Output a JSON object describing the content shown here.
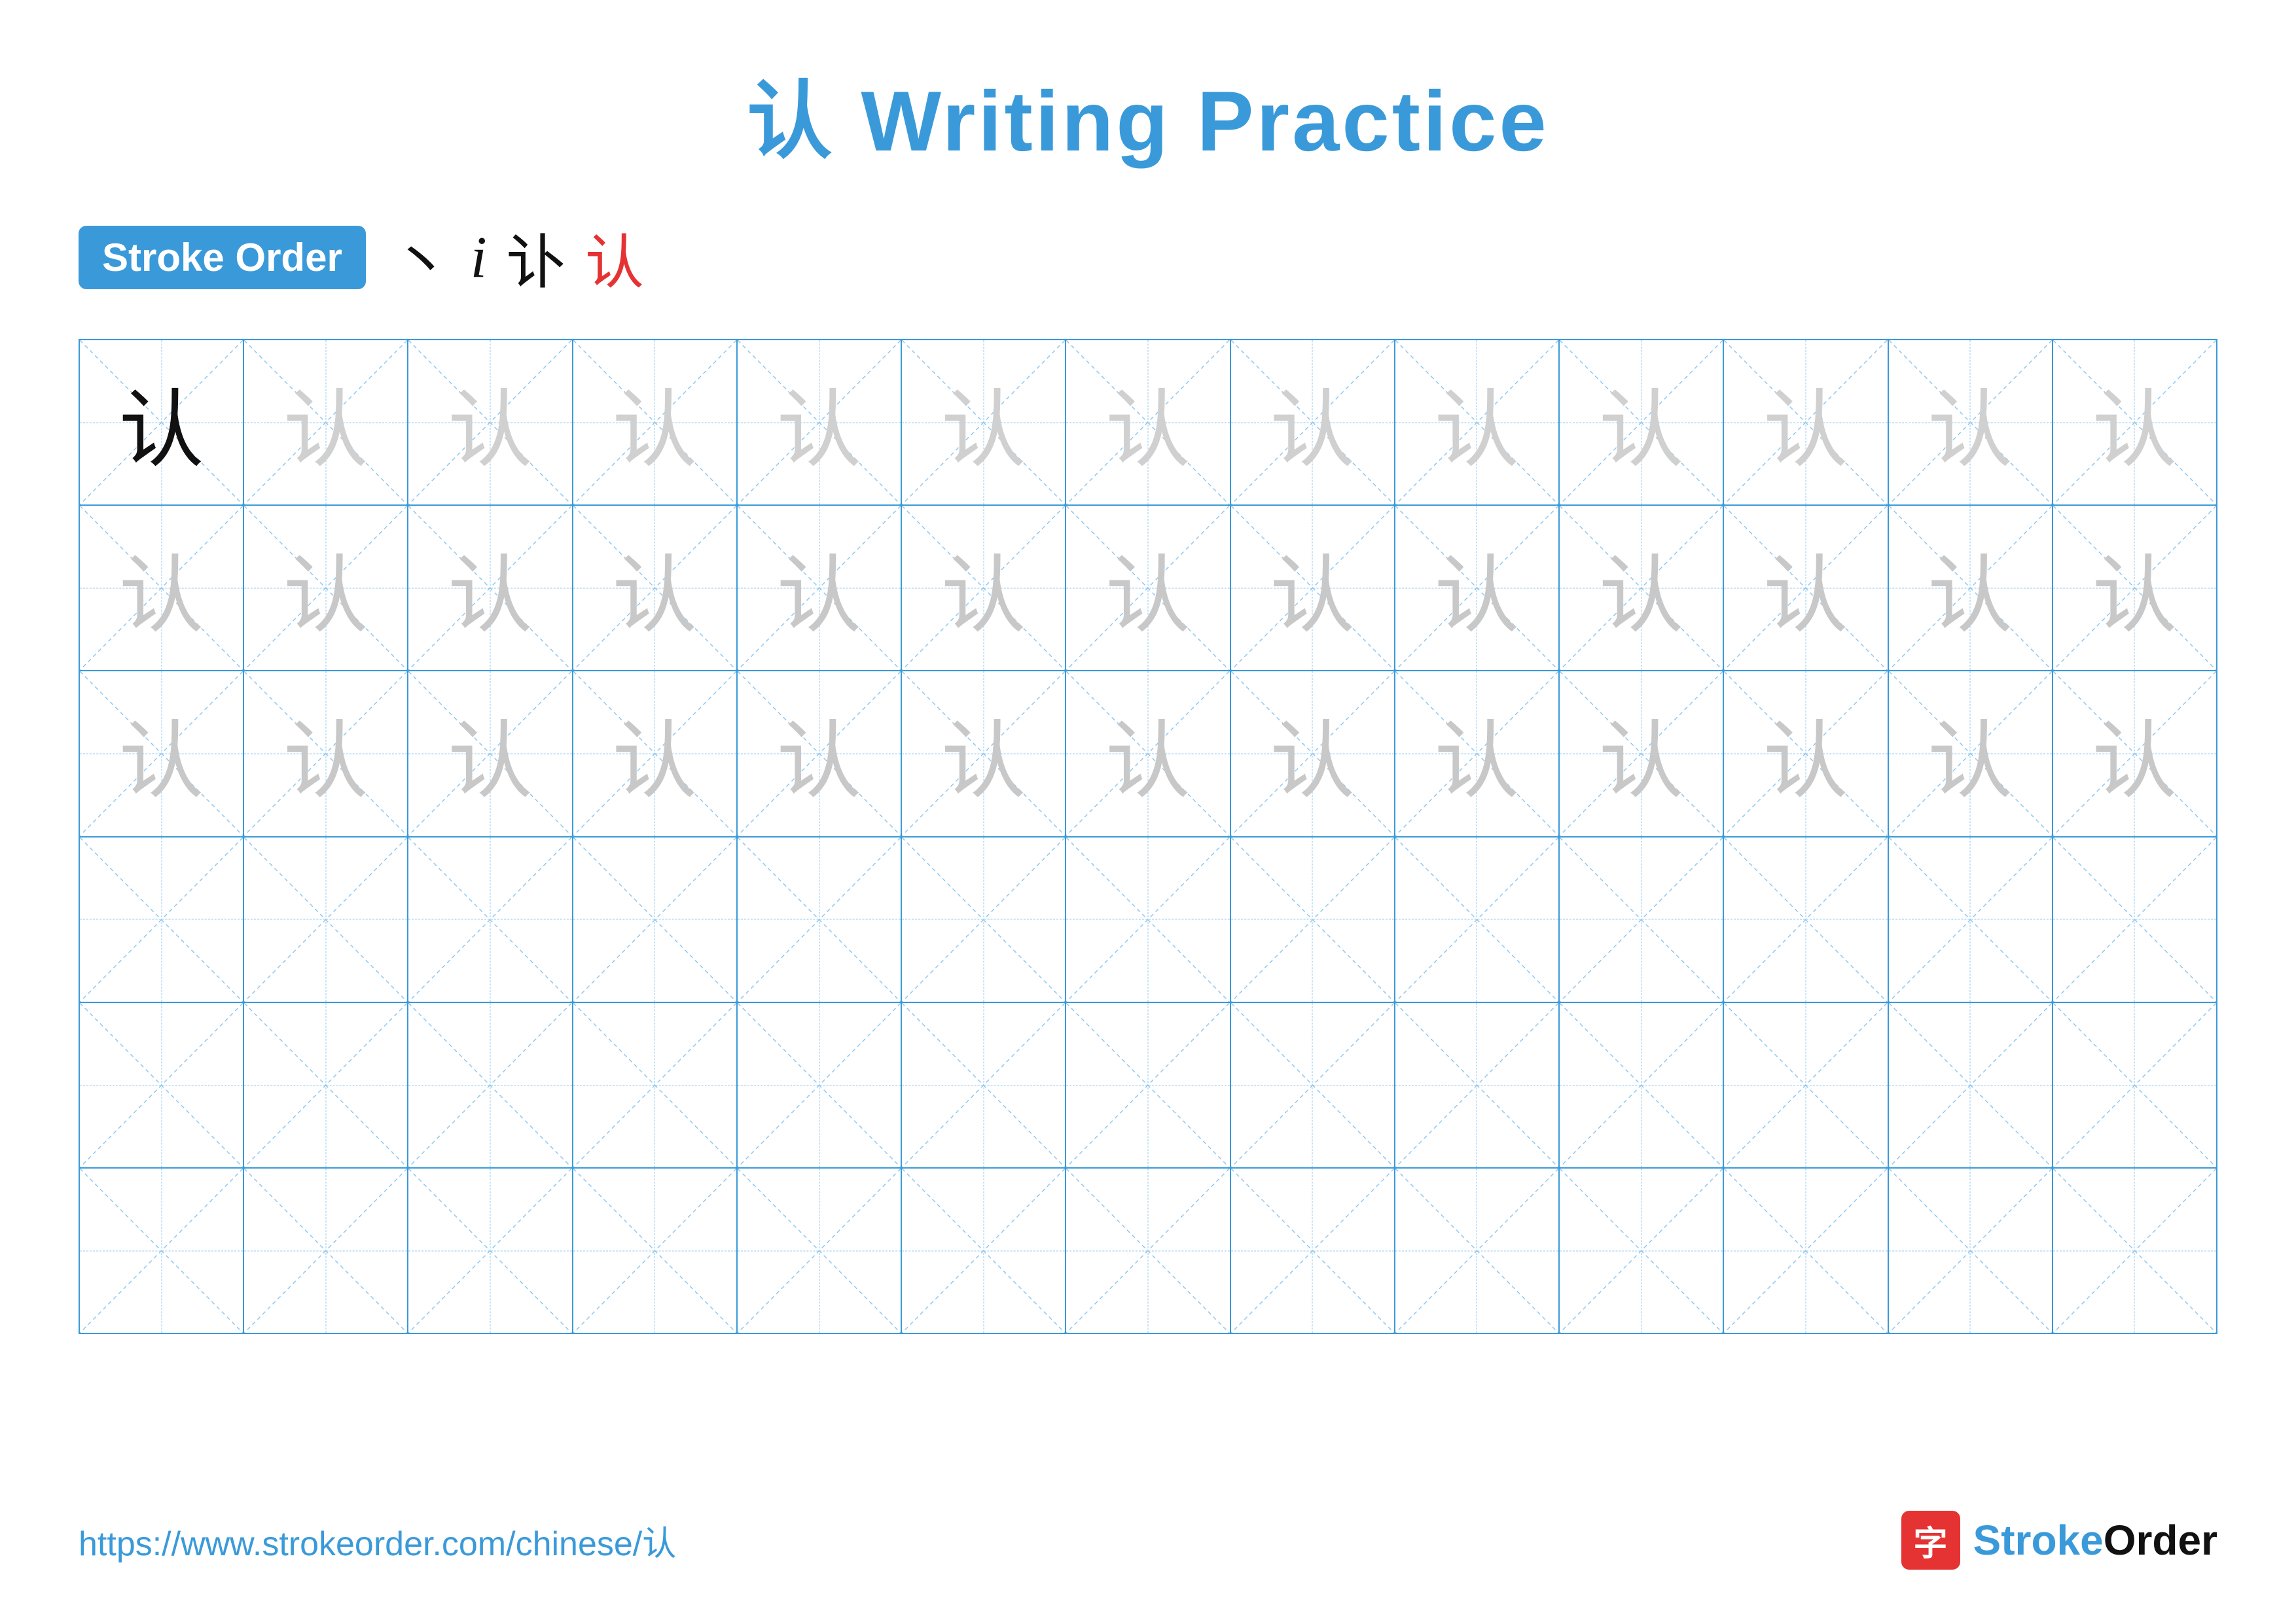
{
  "title": {
    "chinese_char": "认",
    "label": "Writing Practice",
    "full_title": "认 Writing Practice"
  },
  "stroke_order": {
    "badge_label": "Stroke Order",
    "strokes": [
      {
        "char": "丶",
        "color": "black"
      },
      {
        "char": "讠",
        "color": "black"
      },
      {
        "char": "认",
        "color": "black"
      },
      {
        "char": "认",
        "color": "red"
      }
    ]
  },
  "grid": {
    "rows": 6,
    "cols": 13,
    "char": "认",
    "row_types": [
      "solid_then_light",
      "light_all",
      "light_all",
      "empty",
      "empty",
      "empty"
    ]
  },
  "footer": {
    "url": "https://www.strokeorder.com/chinese/认",
    "logo_icon": "字",
    "logo_text": "StrokeOrder"
  }
}
